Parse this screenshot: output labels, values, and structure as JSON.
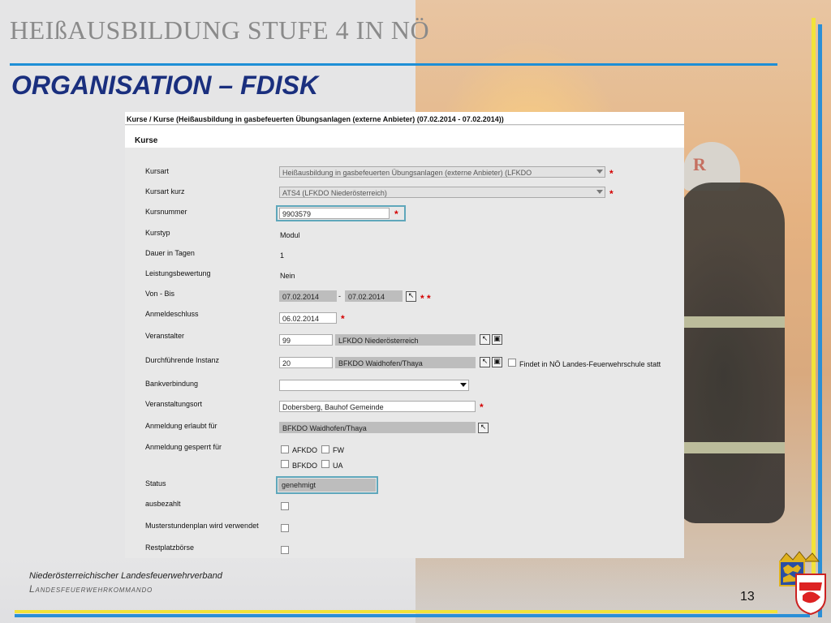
{
  "slide": {
    "title": "HEIßAUSBILDUNG STUFE 4 IN NÖ",
    "subtitle": "ORGANISATION – FDISK",
    "footer_org": "Niederösterreichischer Landesfeuerwehrverband",
    "footer_cmd": "Landesfeuerwehrkommando",
    "page_number": "13",
    "colors": {
      "accent_blue": "#1e8fd6",
      "subtitle": "#1a2f7e",
      "required_star": "#d40000",
      "highlight_border": "#5fa7bb"
    }
  },
  "app": {
    "breadcrumb": "Kurse / Kurse (Heißausbildung in gasbefeuerten Übungsanlagen (externe Anbieter) (07.02.2014 - 07.02.2014))",
    "section_title": "Kurse",
    "required_marker": "*",
    "double_required_marker": "* *",
    "date_separator": "-",
    "fields": {
      "kursart": {
        "label": "Kursart",
        "value": "Heißausbildung in gasbefeuerten Übungsanlagen (externe Anbieter) (LFKDO"
      },
      "kursart_kurz": {
        "label": "Kursart kurz",
        "value": "ATS4 (LFKDO Niederösterreich)"
      },
      "kursnummer": {
        "label": "Kursnummer",
        "value": "9903579"
      },
      "kurstyp": {
        "label": "Kurstyp",
        "value": "Modul"
      },
      "dauer": {
        "label": "Dauer in Tagen",
        "value": "1"
      },
      "leistungsbewertung": {
        "label": "Leistungsbewertung",
        "value": "Nein"
      },
      "von_bis": {
        "label": "Von - Bis",
        "from": "07.02.2014",
        "to": "07.02.2014"
      },
      "anmeldeschluss": {
        "label": "Anmeldeschluss",
        "value": "06.02.2014"
      },
      "veranstalter": {
        "label": "Veranstalter",
        "code": "99",
        "name": "LFKDO Niederösterreich"
      },
      "durchfuehrende_instanz": {
        "label": "Durchführende Instanz",
        "code": "20",
        "name": "BFKDO Waidhofen/Thaya",
        "checkbox_label": "Findet in NÖ Landes-Feuerwehrschule statt"
      },
      "bankverbindung": {
        "label": "Bankverbindung",
        "value": ""
      },
      "veranstaltungsort": {
        "label": "Veranstaltungsort",
        "value": "Dobersberg, Bauhof Gemeinde"
      },
      "anmeldung_erlaubt": {
        "label": "Anmeldung erlaubt für",
        "value": "BFKDO Waidhofen/Thaya"
      },
      "anmeldung_gesperrt": {
        "label": "Anmeldung gesperrt für",
        "options": [
          "AFKDO",
          "FW",
          "BFKDO",
          "UA"
        ]
      },
      "status": {
        "label": "Status",
        "value": "genehmigt"
      },
      "ausbezahlt": {
        "label": "ausbezahlt"
      },
      "musterstundenplan": {
        "label": "Musterstundenplan wird verwendet"
      },
      "restplatzboerse": {
        "label": "Restplatzbörse"
      }
    },
    "icons": {
      "pick": "cursor-arrow-icon",
      "lookup": "window-icon"
    }
  }
}
